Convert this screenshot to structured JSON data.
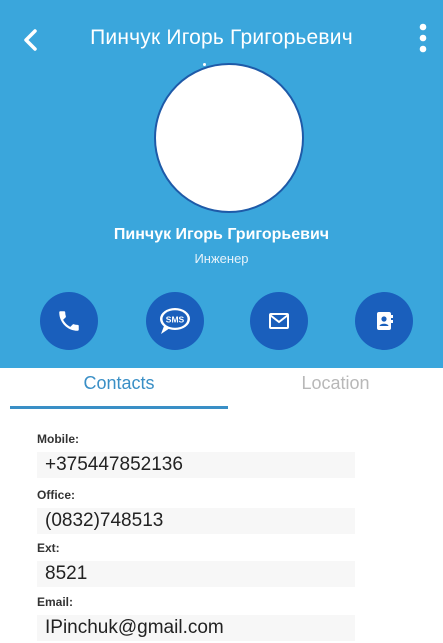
{
  "header": {
    "title": "Пинчук Игорь Григорьевич",
    "accent_color": "#3aa6dc",
    "button_color": "#1a5fbc"
  },
  "profile": {
    "name": "Пинчук Игорь Григорьевич",
    "position": "Инженер"
  },
  "actions": [
    {
      "icon": "phone-icon"
    },
    {
      "icon": "sms-icon",
      "label": "SMS"
    },
    {
      "icon": "mail-icon"
    },
    {
      "icon": "contact-card-icon"
    }
  ],
  "tabs": {
    "contacts": "Contacts",
    "location": "Location"
  },
  "fields": {
    "mobile": {
      "label": "Mobile:",
      "value": "+375447852136"
    },
    "office": {
      "label": "Office:",
      "value": "(0832)748513"
    },
    "ext": {
      "label": "Ext:",
      "value": "8521"
    },
    "email": {
      "label": "Email:",
      "value": "IPinchuk@gmail.com"
    }
  }
}
